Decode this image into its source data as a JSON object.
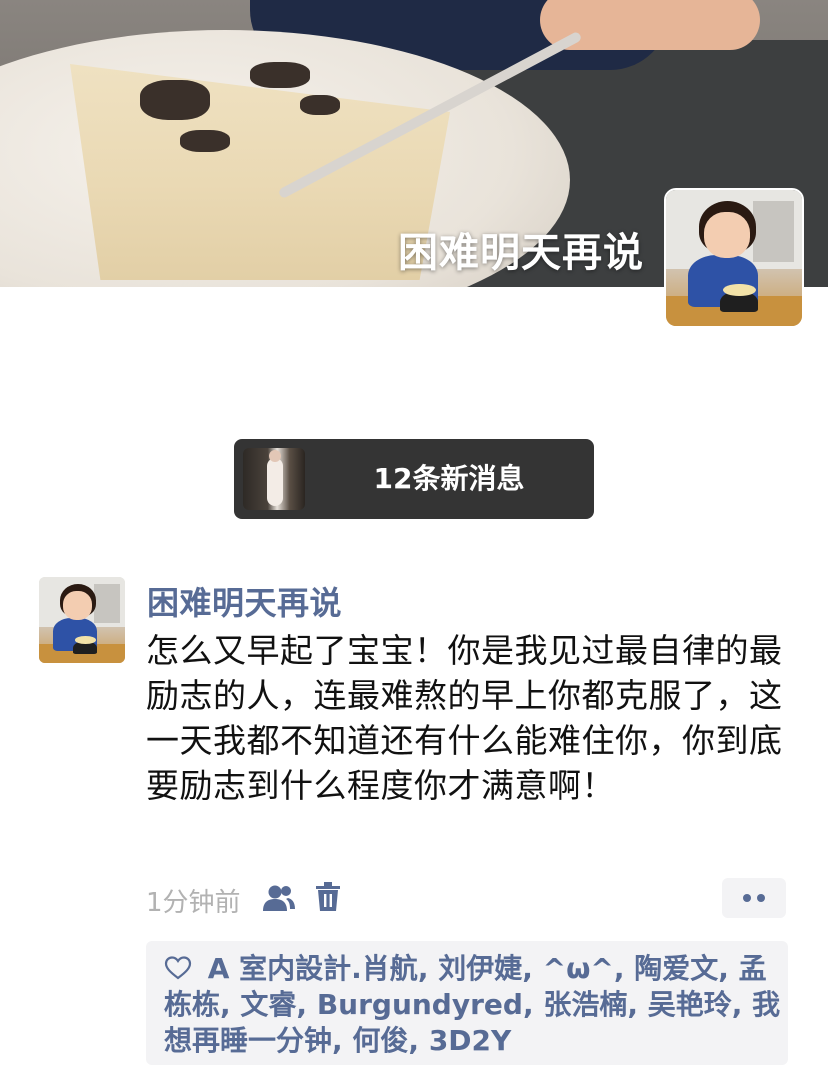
{
  "profile": {
    "cover_title": "困难明天再说"
  },
  "new_messages": {
    "label": "12条新消息"
  },
  "post": {
    "author": "困难明天再说",
    "text": "怎么又早起了宝宝！你是我见过最自律的最励志的人，连最难熬的早上你都克服了，这一天我都不知道还有什么能难住你，你到底要励志到什么程度你才满意啊！",
    "time": "1分钟前",
    "icons": [
      "privacy-icon",
      "delete-icon",
      "more-icon",
      "heart-icon"
    ],
    "likes": [
      "A 室内設計.肖航",
      "刘伊婕",
      "^ω^",
      "陶爱文",
      "孟栋栋",
      "文睿",
      "Burgundyred",
      "张浩楠",
      "吴艳玲",
      "我想再睡一分钟",
      "何俊",
      "3D2Y"
    ],
    "likes_separator": ", "
  },
  "colors": {
    "link_blue": "#576b95",
    "time_gray": "#b2b2b2",
    "panel_bg": "#f3f3f5",
    "toast_bg": "#343434"
  }
}
